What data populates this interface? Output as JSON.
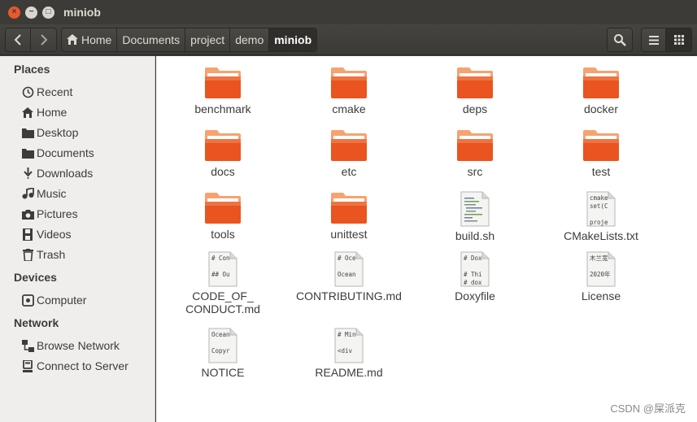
{
  "window": {
    "title": "miniob",
    "close_glyph": "×",
    "minimize_glyph": "−",
    "maximize_glyph": "□"
  },
  "toolbar": {
    "back_icon": "chevron-left-icon",
    "forward_icon": "chevron-right-icon",
    "breadcrumbs": [
      "Home",
      "Documents",
      "project",
      "demo",
      "miniob"
    ],
    "search_icon": "search-icon",
    "list_icon": "list-view-icon",
    "grid_icon": "grid-view-icon"
  },
  "sidebar": {
    "places_title": "Places",
    "places": [
      {
        "label": "Recent",
        "icon": "clock-icon"
      },
      {
        "label": "Home",
        "icon": "home-icon"
      },
      {
        "label": "Desktop",
        "icon": "folder-icon"
      },
      {
        "label": "Documents",
        "icon": "folder-icon"
      },
      {
        "label": "Downloads",
        "icon": "download-icon"
      },
      {
        "label": "Music",
        "icon": "music-icon"
      },
      {
        "label": "Pictures",
        "icon": "camera-icon"
      },
      {
        "label": "Videos",
        "icon": "film-icon"
      },
      {
        "label": "Trash",
        "icon": "trash-icon"
      }
    ],
    "devices_title": "Devices",
    "devices": [
      {
        "label": "Computer",
        "icon": "drive-icon"
      }
    ],
    "network_title": "Network",
    "network": [
      {
        "label": "Browse Network",
        "icon": "network-icon"
      },
      {
        "label": "Connect to Server",
        "icon": "server-icon"
      }
    ]
  },
  "files": [
    {
      "name": "benchmark",
      "type": "folder"
    },
    {
      "name": "cmake",
      "type": "folder"
    },
    {
      "name": "deps",
      "type": "folder"
    },
    {
      "name": "docker",
      "type": "folder"
    },
    {
      "name": "docs",
      "type": "folder"
    },
    {
      "name": "etc",
      "type": "folder"
    },
    {
      "name": "src",
      "type": "folder"
    },
    {
      "name": "test",
      "type": "folder"
    },
    {
      "name": "tools",
      "type": "folder"
    },
    {
      "name": "unittest",
      "type": "folder"
    },
    {
      "name": "build.sh",
      "type": "script"
    },
    {
      "name": "CMakeLists.txt",
      "type": "text",
      "preview": [
        "cmake",
        "set(C",
        "",
        "proje"
      ]
    },
    {
      "name": "CODE_OF_\nCONDUCT.md",
      "type": "text",
      "preview": [
        "# Con",
        "",
        "## Ou"
      ]
    },
    {
      "name": "CONTRIBUTING.md",
      "type": "text",
      "preview": [
        "# Oce",
        "",
        "Ocean"
      ]
    },
    {
      "name": "Doxyfile",
      "type": "text",
      "preview": [
        "# Dox",
        "",
        "# Thi",
        "# dox"
      ]
    },
    {
      "name": "License",
      "type": "text",
      "preview": [
        "木兰宽",
        "",
        "2020年"
      ]
    },
    {
      "name": "NOTICE",
      "type": "text",
      "preview": [
        "Ocean",
        "",
        "Copyr"
      ]
    },
    {
      "name": "README.md",
      "type": "text",
      "preview": [
        "# Min",
        "",
        "<div"
      ]
    }
  ],
  "watermark": "CSDN @屎派克",
  "colors": {
    "folder_top": "#f7a26f",
    "folder_body": "#e95420",
    "titlebar": "#3c3b37",
    "sidebar": "#efeeec"
  }
}
